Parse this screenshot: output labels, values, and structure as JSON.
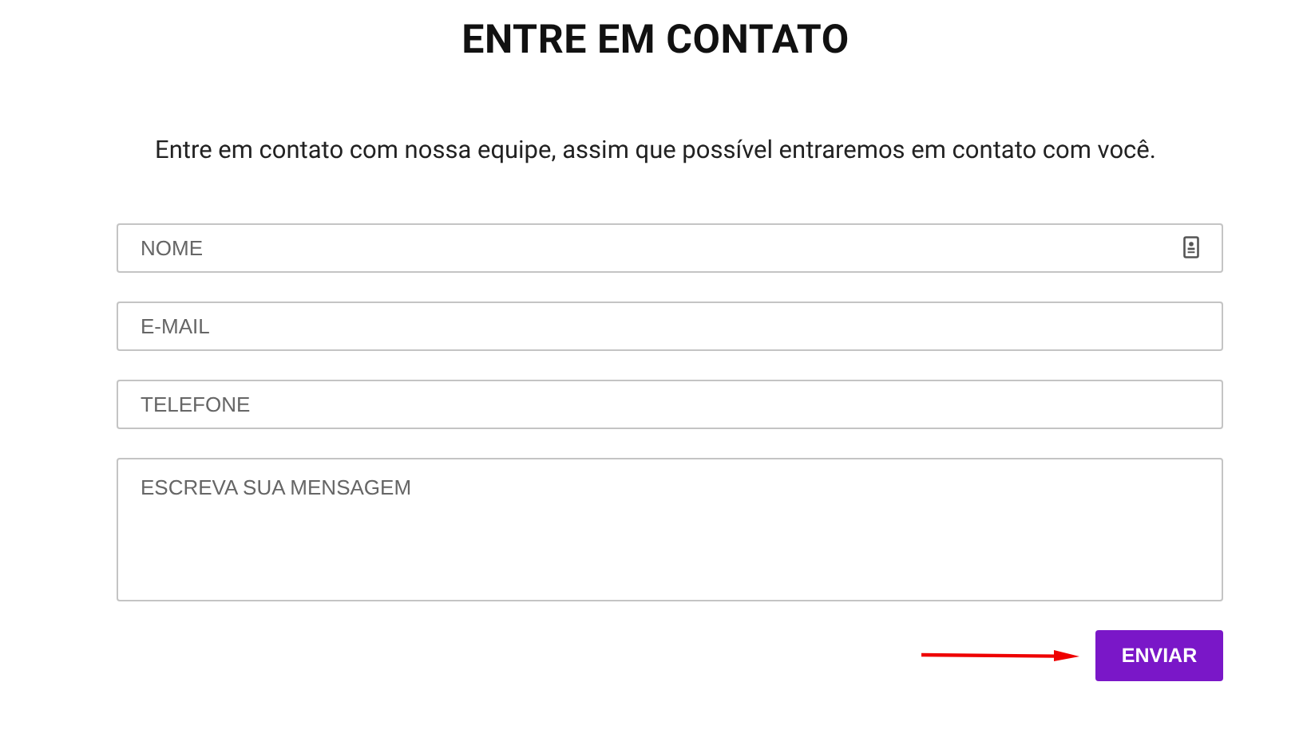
{
  "title": "ENTRE EM CONTATO",
  "subtitle": "Entre em contato com nossa equipe, assim que possível entraremos em contato com você.",
  "fields": [
    {
      "kind": "input",
      "placeholder": "NOME",
      "has_icon": true
    },
    {
      "kind": "input",
      "placeholder": "E-MAIL",
      "has_icon": false
    },
    {
      "kind": "input",
      "placeholder": "TELEFONE",
      "has_icon": false
    },
    {
      "kind": "textarea",
      "placeholder": "ESCREVA SUA MENSAGEM",
      "has_icon": false
    }
  ],
  "submit_button": "ENVIAR"
}
